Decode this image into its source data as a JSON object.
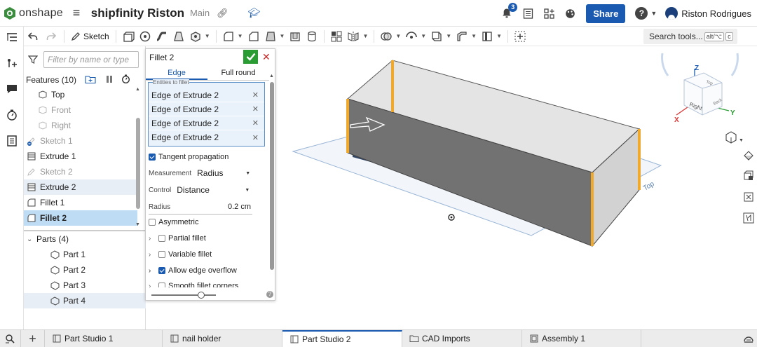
{
  "app": {
    "logo_text": "onshape",
    "doc_title": "shipfinity Riston",
    "branch": "Main",
    "notification_count": "3",
    "share_label": "Share",
    "user_name": "Riston Rodrigues"
  },
  "toolbar": {
    "sketch_label": "Sketch",
    "search_label": "Search tools...",
    "search_shortcut_1": "alt/⌥",
    "search_shortcut_2": "c"
  },
  "feature_panel": {
    "filter_placeholder": "Filter by name or type",
    "features_header": "Features (10)",
    "items": [
      {
        "label": "Top",
        "state": "normal"
      },
      {
        "label": "Front",
        "state": "dim"
      },
      {
        "label": "Right",
        "state": "dim"
      },
      {
        "label": "Sketch 1",
        "state": "dim"
      },
      {
        "label": "Extrude 1",
        "state": "normal"
      },
      {
        "label": "Sketch 2",
        "state": "dim"
      },
      {
        "label": "Extrude 2",
        "state": "highlight"
      },
      {
        "label": "Fillet 1",
        "state": "normal"
      },
      {
        "label": "Fillet 2",
        "state": "selected"
      }
    ],
    "parts_header": "Parts (4)",
    "parts": [
      "Part 1",
      "Part 2",
      "Part 3",
      "Part 4"
    ]
  },
  "fillet_dialog": {
    "title": "Fillet 2",
    "tabs": [
      "Edge",
      "Full round"
    ],
    "active_tab": "Edge",
    "entities_label": "Entities to fillet",
    "entities": [
      "Edge of Extrude 2",
      "Edge of Extrude 2",
      "Edge of Extrude 2",
      "Edge of Extrude 2"
    ],
    "tangent_propagation": {
      "label": "Tangent propagation",
      "checked": true
    },
    "measurement": {
      "label": "Measurement",
      "value": "Radius"
    },
    "control": {
      "label": "Control",
      "value": "Distance"
    },
    "radius": {
      "label": "Radius",
      "value": "0.2 cm"
    },
    "asymmetric": {
      "label": "Asymmetric",
      "checked": false
    },
    "partial_fillet": {
      "label": "Partial fillet",
      "checked": false
    },
    "variable_fillet": {
      "label": "Variable fillet",
      "checked": false
    },
    "allow_edge_overflow": {
      "label": "Allow edge overflow",
      "checked": true
    },
    "smooth_fillet_corners": {
      "label": "Smooth fillet corners",
      "checked": false
    },
    "slider_level": 0.72
  },
  "viewcube": {
    "z": "Z",
    "x": "X",
    "y": "Y",
    "face_front": "Right",
    "face_top": "Top",
    "face_side": "Back",
    "plane_label": "Top"
  },
  "bottom_tabs": [
    {
      "label": "Part Studio 1",
      "active": false
    },
    {
      "label": "nail holder",
      "active": false
    },
    {
      "label": "Part Studio 2",
      "active": true
    },
    {
      "label": "CAD Imports",
      "active": false
    },
    {
      "label": "Assembly 1",
      "active": false
    }
  ],
  "colors": {
    "brand_blue": "#1a5ab0",
    "confirm_green": "#2a9c34",
    "cancel_red": "#c62828",
    "edge_highlight": "#f0a92a"
  }
}
